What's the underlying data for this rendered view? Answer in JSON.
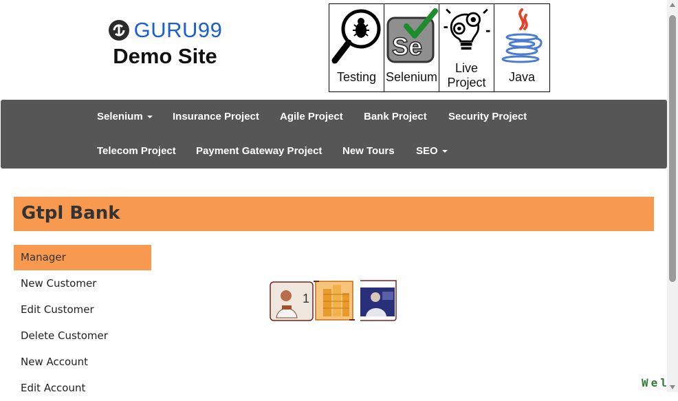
{
  "header": {
    "logo_text": "GURU99",
    "site_title": "Demo Site"
  },
  "courses": [
    {
      "label": "Testing",
      "icon": "magnifier-bug-icon"
    },
    {
      "label": "Selenium",
      "icon": "selenium-logo-icon"
    },
    {
      "label": "Live\nProject",
      "icon": "lightbulb-gears-icon"
    },
    {
      "label": "Java",
      "icon": "java-cup-icon"
    }
  ],
  "nav": {
    "row1": [
      "Selenium",
      "Insurance Project",
      "Agile Project",
      "Bank Project",
      "Security Project"
    ],
    "row2": [
      "Telecom Project",
      "Payment Gateway Project",
      "New Tours",
      "SEO"
    ]
  },
  "bank": {
    "title": "Gtpl Bank"
  },
  "menu": [
    "Manager",
    "New Customer",
    "Edit Customer",
    "Delete Customer",
    "New Account",
    "Edit Account"
  ],
  "marquee": {
    "visible_text": "Wel"
  },
  "colors": {
    "accent": "#f7994e",
    "nav_bg": "#565656",
    "logo_blue": "#1b5fd1"
  }
}
